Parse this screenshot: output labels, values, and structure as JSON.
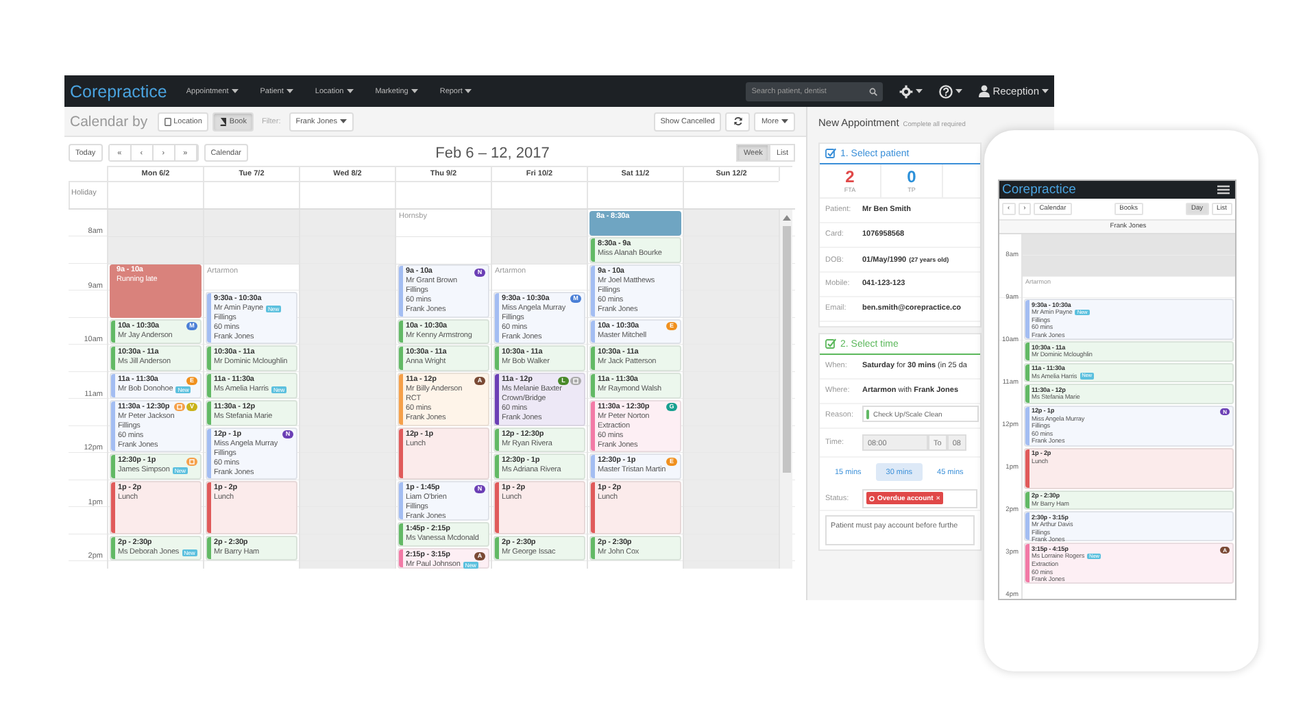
{
  "navbar": {
    "logo": "Corepractice",
    "menus": [
      "Appointment",
      "Patient",
      "Location",
      "Marketing",
      "Report"
    ],
    "search": {
      "placeholder": "Search patient, dentist"
    },
    "user": "Reception"
  },
  "toolbar": {
    "title": "Calendar by",
    "modes": [
      {
        "label": "Location",
        "selected": false
      },
      {
        "label": "Book",
        "selected": true
      }
    ],
    "filter_label": "Filter:",
    "filter_value": "Frank Jones",
    "show_cancelled": "Show Cancelled",
    "more": "More"
  },
  "calendar": {
    "today": "Today",
    "arrows": [
      "«",
      "‹",
      "›",
      "»"
    ],
    "calendar_button": "Calendar",
    "title": "Feb 6 – 12, 2017",
    "views": [
      {
        "label": "Week",
        "selected": true
      },
      {
        "label": "List",
        "selected": false
      }
    ],
    "holiday_label": "Holiday",
    "hours": [
      "8am",
      "9am",
      "10am",
      "11am",
      "12pm",
      "1pm",
      "2pm"
    ],
    "days": [
      {
        "label": "Mon 6/2",
        "closed": false,
        "late_start": true,
        "events": [
          {
            "kind": "block",
            "color": "#d9827c",
            "time": "9a - 10a",
            "name": "Running late"
          },
          {
            "kind": "appointment",
            "color": "#62b965",
            "time": "10a - 10:30a",
            "name": "Mr Jay Anderson",
            "badges": [
              {
                "kind": "letter",
                "text": "M",
                "color": "#4a7fd6"
              }
            ]
          },
          {
            "kind": "appointment",
            "color": "#62b965",
            "time": "10:30a - 11a",
            "name": "Ms Jill Anderson"
          },
          {
            "kind": "appointment",
            "color": "#a3bdf2",
            "time": "11a - 11:30a",
            "name": "Mr Bob Donohoe",
            "tag": "New",
            "badges": [
              {
                "kind": "letter",
                "text": "E",
                "color": "#f0901e"
              }
            ]
          },
          {
            "kind": "appointment",
            "color": "#a3bdf2",
            "time": "11:30a - 12:30p",
            "name": "Mr Peter Jackson",
            "details": [
              "Fillings",
              "60 mins",
              "Frank Jones"
            ],
            "badges": [
              {
                "kind": "icon",
                "color": "#f5a04a"
              },
              {
                "kind": "letter",
                "text": "V",
                "color": "#c9b21a"
              }
            ]
          },
          {
            "kind": "appointment",
            "color": "#62b965",
            "time": "12:30p - 1p",
            "name": "James Simpson",
            "tag": "New",
            "badges": [
              {
                "kind": "icon",
                "color": "#f5a04a"
              }
            ]
          },
          {
            "kind": "appointment",
            "color": "#e05a5a",
            "time": "1p - 2p",
            "name": "Lunch"
          },
          {
            "kind": "appointment",
            "color": "#62b965",
            "time": "2p - 2:30p",
            "name": "Ms Deborah Jones",
            "tag": "New"
          }
        ]
      },
      {
        "label": "Tue 7/2",
        "closed": false,
        "late_start": true,
        "location": "Artarmon",
        "events": [
          {
            "kind": "appointment",
            "color": "#a3bdf2",
            "time": "9:30a - 10:30a",
            "name": "Mr Amin Payne",
            "tag": "New",
            "details": [
              "Fillings",
              "60 mins",
              "Frank Jones"
            ]
          },
          {
            "kind": "appointment",
            "color": "#62b965",
            "time": "10:30a - 11a",
            "name": "Mr Dominic Mcloughlin"
          },
          {
            "kind": "appointment",
            "color": "#62b965",
            "time": "11a - 11:30a",
            "name": "Ms Amelia Harris",
            "tag": "New"
          },
          {
            "kind": "appointment",
            "color": "#62b965",
            "time": "11:30a - 12p",
            "name": "Ms Stefania Marie"
          },
          {
            "kind": "appointment",
            "color": "#a3bdf2",
            "time": "12p - 1p",
            "name": "Miss Angela Murray",
            "details": [
              "Fillings",
              "60 mins",
              "Frank Jones"
            ],
            "badges": [
              {
                "kind": "letter",
                "text": "N",
                "color": "#6b3fb5"
              }
            ]
          },
          {
            "kind": "appointment",
            "color": "#e05a5a",
            "time": "1p - 2p",
            "name": "Lunch"
          },
          {
            "kind": "appointment",
            "color": "#62b965",
            "time": "2p - 2:30p",
            "name": "Mr Barry Ham"
          }
        ]
      },
      {
        "label": "Wed 8/2",
        "closed": true
      },
      {
        "label": "Thu 9/2",
        "closed": false,
        "late_start": false,
        "location": "Hornsby",
        "events": [
          {
            "kind": "appointment",
            "color": "#a3bdf2",
            "time": "9a - 10a",
            "name": "Mr Grant Brown",
            "details": [
              "Fillings",
              "60 mins",
              "Frank Jones"
            ],
            "badges": [
              {
                "kind": "letter",
                "text": "N",
                "color": "#6b3fb5"
              }
            ]
          },
          {
            "kind": "appointment",
            "color": "#62b965",
            "time": "10a - 10:30a",
            "name": "Mr Kenny Armstrong"
          },
          {
            "kind": "appointment",
            "color": "#62b965",
            "time": "10:30a - 11a",
            "name": "Anna Wright"
          },
          {
            "kind": "appointment",
            "color": "#f5a04a",
            "time": "11a - 12p",
            "name": "Mr Billy Anderson",
            "details": [
              "RCT",
              "60 mins",
              "Frank Jones"
            ],
            "badges": [
              {
                "kind": "letter",
                "text": "A",
                "color": "#7a4a35"
              }
            ]
          },
          {
            "kind": "appointment",
            "color": "#e05a5a",
            "time": "12p - 1p",
            "name": "Lunch"
          },
          {
            "kind": "appointment",
            "color": "#a3bdf2",
            "time": "1p - 1:45p",
            "name": "Liam O'brien",
            "details": [
              "Fillings",
              "Frank Jones"
            ],
            "badges": [
              {
                "kind": "letter",
                "text": "N",
                "color": "#6b3fb5"
              }
            ]
          },
          {
            "kind": "appointment",
            "color": "#62b965",
            "time": "1:45p - 2:15p",
            "name": "Ms Vanessa Mcdonald"
          },
          {
            "kind": "appointment",
            "color": "#f27aa6",
            "time": "2:15p - 3:15p",
            "name": "Mr Paul Johnson",
            "tag": "New",
            "badges": [
              {
                "kind": "letter",
                "text": "A",
                "color": "#7a4a35"
              }
            ]
          }
        ]
      },
      {
        "label": "Fri 10/2",
        "closed": false,
        "late_start": true,
        "location": "Artarmon",
        "events": [
          {
            "kind": "appointment",
            "color": "#a3bdf2",
            "time": "9:30a - 10:30a",
            "name": "Miss Angela Murray",
            "details": [
              "Fillings",
              "60 mins",
              "Frank Jones"
            ],
            "badges": [
              {
                "kind": "letter",
                "text": "M",
                "color": "#4a7fd6"
              }
            ]
          },
          {
            "kind": "appointment",
            "color": "#62b965",
            "time": "10:30a - 11a",
            "name": "Mr Bob Walker"
          },
          {
            "kind": "appointment",
            "color": "#6b3fb5",
            "time": "11a - 12p",
            "name": "Ms Melanie Baxter",
            "details": [
              "Crown/Bridge",
              "60 mins",
              "Frank Jones"
            ],
            "badges": [
              {
                "kind": "letter",
                "text": "L",
                "color": "#4a8a2a"
              },
              {
                "kind": "icon",
                "color": "#aaaaaa"
              }
            ]
          },
          {
            "kind": "appointment",
            "color": "#62b965",
            "time": "12p - 12:30p",
            "name": "Mr Ryan Rivera"
          },
          {
            "kind": "appointment",
            "color": "#62b965",
            "time": "12:30p - 1p",
            "name": "Ms Adriana Rivera"
          },
          {
            "kind": "appointment",
            "color": "#e05a5a",
            "time": "1p - 2p",
            "name": "Lunch"
          },
          {
            "kind": "appointment",
            "color": "#62b965",
            "time": "2p - 2:30p",
            "name": "Mr George Issac"
          }
        ]
      },
      {
        "label": "Sat 11/2",
        "closed": false,
        "events": [
          {
            "kind": "block",
            "color": "#6fa5c2",
            "time": "8a - 8:30a"
          },
          {
            "kind": "appointment",
            "color": "#62b965",
            "time": "8:30a - 9a",
            "name": "Miss Alanah Bourke"
          },
          {
            "kind": "appointment",
            "color": "#a3bdf2",
            "time": "9a - 10a",
            "name": "Mr Joel Matthews",
            "details": [
              "Fillings",
              "60 mins",
              "Frank Jones"
            ]
          },
          {
            "kind": "appointment",
            "color": "#a3bdf2",
            "time": "10a - 10:30a",
            "name": "Master Mitchell",
            "badges": [
              {
                "kind": "letter",
                "text": "E",
                "color": "#f0901e"
              }
            ]
          },
          {
            "kind": "appointment",
            "color": "#62b965",
            "time": "10:30a - 11a",
            "name": "Mr Jack Patterson"
          },
          {
            "kind": "appointment",
            "color": "#62b965",
            "time": "11a - 11:30a",
            "name": "Mr Raymond Walsh"
          },
          {
            "kind": "appointment",
            "color": "#f27aa6",
            "time": "11:30a - 12:30p",
            "name": "Mr Peter Norton",
            "details": [
              "Extraction",
              "60 mins",
              "Frank Jones"
            ],
            "badges": [
              {
                "kind": "letter",
                "text": "G",
                "color": "#18a090"
              }
            ]
          },
          {
            "kind": "appointment",
            "color": "#a3bdf2",
            "time": "12:30p - 1p",
            "name": "Master Tristan Martin",
            "badges": [
              {
                "kind": "letter",
                "text": "E",
                "color": "#f0901e"
              }
            ]
          },
          {
            "kind": "appointment",
            "color": "#e05a5a",
            "time": "1p - 2p",
            "name": "Lunch"
          },
          {
            "kind": "appointment",
            "color": "#62b965",
            "time": "2p - 2:30p",
            "name": "Mr John Cox"
          }
        ]
      },
      {
        "label": "Sun 12/2",
        "closed": true
      }
    ]
  },
  "panel": {
    "title": "New Appointment",
    "subtitle": "Complete all required",
    "patient": {
      "step": "1. Select patient",
      "checked": true,
      "color": "#3a8fd8",
      "stats": [
        {
          "value": "2",
          "label": "FTA",
          "color": "#e04848"
        },
        {
          "value": "0",
          "label": "TP",
          "color": "#2b90d9"
        }
      ],
      "fields": [
        {
          "label": "Patient:",
          "value": "Mr Ben Smith"
        },
        {
          "label": "Card:",
          "value": "1076958568"
        },
        {
          "label": "DOB:",
          "value": "01/May/1990",
          "note": "(27 years old)"
        },
        {
          "label": "Mobile:",
          "value": "041-123-123"
        },
        {
          "label": "Email:",
          "value": "ben.smith@corepractice.co"
        }
      ]
    },
    "time": {
      "step": "2. Select time",
      "checked": true,
      "color": "#5cb85c",
      "rows": [
        {
          "label": "When:",
          "value": "**Saturday** for **30 mins** (in 25 da"
        },
        {
          "label": "Where:",
          "value": "**Artarmon** with **Frank Jones**"
        }
      ],
      "reason": {
        "label": "Reason:",
        "value": "Check Up/Scale Clean",
        "color": "#62b965"
      },
      "time": {
        "label": "Time:",
        "from": "08:00",
        "to_label": "To",
        "to": "08"
      },
      "durations": [
        {
          "label": "15 mins",
          "selected": false
        },
        {
          "label": "30 mins",
          "selected": true
        },
        {
          "label": "45 mins",
          "selected": false
        }
      ],
      "status": {
        "label": "Status:",
        "value": "Overdue account",
        "remove": "×"
      },
      "note": "Patient must pay account before furthe"
    }
  },
  "phone": {
    "logo": "Corepractice",
    "arrows": [
      "‹",
      "›"
    ],
    "calendar_button": "Calendar",
    "books_button": "Books",
    "views": [
      {
        "label": "Day",
        "selected": true
      },
      {
        "label": "List",
        "selected": false
      }
    ],
    "column": "Frank Jones",
    "hours": [
      "8am",
      "9am",
      "10am",
      "11am",
      "12pm",
      "1pm",
      "2pm",
      "3pm",
      "4pm"
    ],
    "late_start": true,
    "location": "Artarmon",
    "events": [
      {
        "kind": "appointment",
        "color": "#a3bdf2",
        "time": "9:30a - 10:30a",
        "name": "Mr Amin Payne",
        "tag": "New",
        "details": [
          "Fillings",
          "60 mins",
          "Frank Jones"
        ]
      },
      {
        "kind": "appointment",
        "color": "#62b965",
        "time": "10:30a - 11a",
        "name": "Mr Dominic Mcloughlin"
      },
      {
        "kind": "appointment",
        "color": "#62b965",
        "time": "11a - 11:30a",
        "name": "Ms Amelia Harris",
        "tag": "New"
      },
      {
        "kind": "appointment",
        "color": "#62b965",
        "time": "11:30a - 12p",
        "name": "Ms Stefania Marie"
      },
      {
        "kind": "appointment",
        "color": "#a3bdf2",
        "time": "12p - 1p",
        "name": "Miss Angela Murray",
        "details": [
          "Fillings",
          "60 mins",
          "Frank Jones"
        ],
        "badges": [
          {
            "kind": "letter",
            "text": "N",
            "color": "#6b3fb5"
          }
        ]
      },
      {
        "kind": "appointment",
        "color": "#e05a5a",
        "time": "1p - 2p",
        "name": "Lunch"
      },
      {
        "kind": "appointment",
        "color": "#62b965",
        "time": "2p - 2:30p",
        "name": "Mr Barry Ham"
      },
      {
        "kind": "appointment",
        "color": "#a3bdf2",
        "time": "2:30p - 3:15p",
        "name": "Mr Arthur Davis",
        "details": [
          "Fillings",
          "Frank Jones"
        ]
      },
      {
        "kind": "appointment",
        "color": "#f27aa6",
        "time": "3:15p - 4:15p",
        "name": "Ms Lorraine Rogers",
        "tag": "New",
        "details": [
          "Extraction",
          "60 mins",
          "Frank Jones"
        ],
        "badges": [
          {
            "kind": "letter",
            "text": "A",
            "color": "#7a4a35"
          }
        ]
      }
    ]
  }
}
